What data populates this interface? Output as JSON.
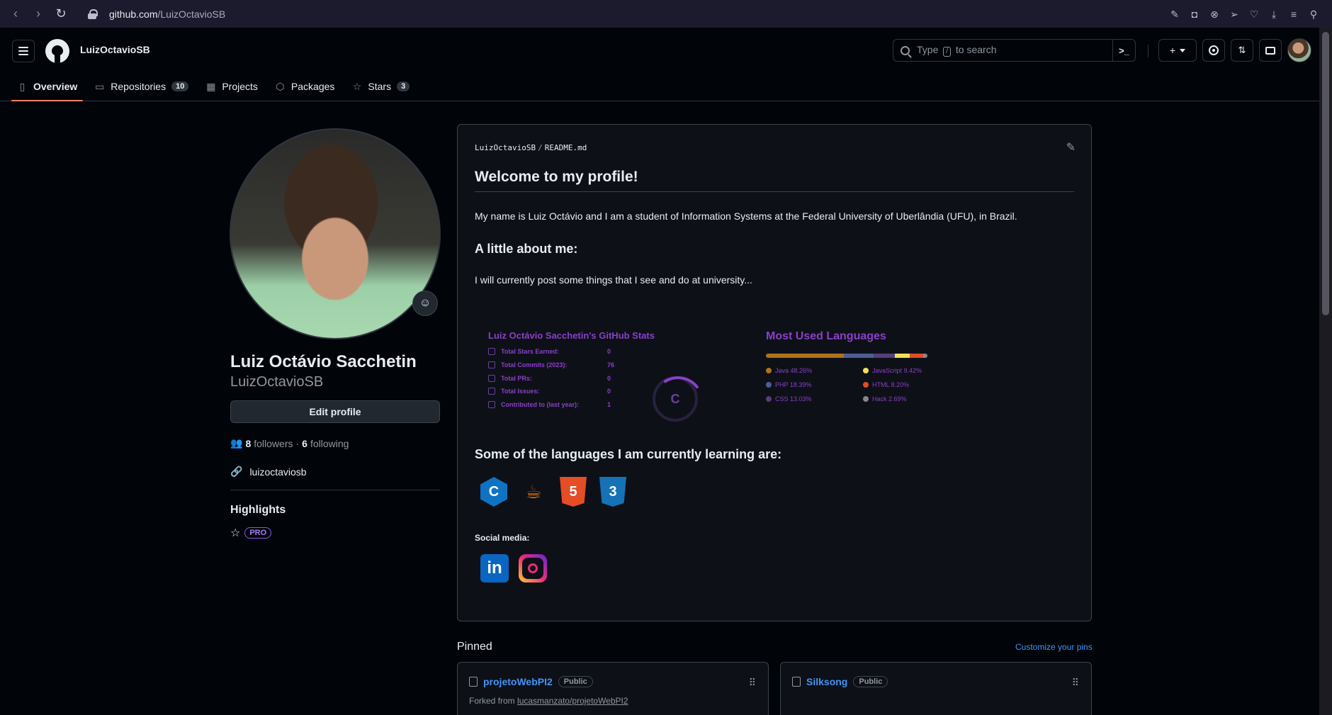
{
  "browser": {
    "url_host": "github.com",
    "url_path": "/LuizOctavioSB"
  },
  "header": {
    "username": "LuizOctavioSB",
    "search_prefix": "Type",
    "search_key": "/",
    "search_suffix": "to search",
    "plus_label": "+"
  },
  "tabs": [
    {
      "label": "Overview",
      "icon": "book-icon"
    },
    {
      "label": "Repositories",
      "icon": "repo-icon",
      "count": "10"
    },
    {
      "label": "Projects",
      "icon": "table-icon"
    },
    {
      "label": "Packages",
      "icon": "package-icon"
    },
    {
      "label": "Stars",
      "icon": "star-icon",
      "count": "3"
    }
  ],
  "profile": {
    "name": "Luiz Octávio Sacchetin",
    "login": "LuizOctavioSB",
    "edit_label": "Edit profile",
    "followers_count": "8",
    "followers_label": "followers",
    "dot": "·",
    "following_count": "6",
    "following_label": "following",
    "link": "luizoctaviosb",
    "highlights_title": "Highlights",
    "pro_label": "PRO"
  },
  "readme": {
    "crumb_user": "LuizOctavioSB",
    "crumb_sep": "/",
    "crumb_file": "README.md",
    "h1": "Welcome to my profile!",
    "intro": "My name is Luiz Octávio and I am a student of Information Systems at the Federal University of Uberlândia (UFU), in Brazil.",
    "about_title": "A little about me:",
    "about_text": "I will currently post some things that I see and do at university...",
    "learning_title": "Some of the languages I am currently learning are:",
    "social_title": "Social media:"
  },
  "stats_card": {
    "title": "Luiz Octávio Sacchetin's GitHub Stats",
    "rows": [
      {
        "label": "Total Stars Earned:",
        "value": "0"
      },
      {
        "label": "Total Commits (2023):",
        "value": "76"
      },
      {
        "label": "Total PRs:",
        "value": "0"
      },
      {
        "label": "Total Issues:",
        "value": "0"
      },
      {
        "label": "Contributed to (last year):",
        "value": "1"
      }
    ],
    "rank": "C"
  },
  "langs_card": {
    "title": "Most Used Languages",
    "items": [
      {
        "label": "Java 48.26%",
        "pct": 48.26,
        "color": "#b07219"
      },
      {
        "label": "JavaScript 9.42%",
        "pct": 9.42,
        "color": "#f1e05a"
      },
      {
        "label": "PHP 18.39%",
        "pct": 18.39,
        "color": "#4F5D95"
      },
      {
        "label": "HTML 8.20%",
        "pct": 8.2,
        "color": "#e34c26"
      },
      {
        "label": "CSS 13.03%",
        "pct": 13.03,
        "color": "#563d7c"
      },
      {
        "label": "Hack 2.69%",
        "pct": 2.69,
        "color": "#878787"
      }
    ]
  },
  "tech_icons": {
    "c": "C",
    "java": "☕",
    "html": "5",
    "css": "3"
  },
  "social": {
    "linkedin": "in"
  },
  "pinned": {
    "title": "Pinned",
    "customize": "Customize your pins",
    "repos": [
      {
        "name": "projetoWebPI2",
        "visibility": "Public",
        "forked_prefix": "Forked from",
        "forked_from": "lucasmanzato/projetoWebPI2"
      },
      {
        "name": "Silksong",
        "visibility": "Public"
      }
    ]
  },
  "colors": {
    "accent_underline": "#f78166",
    "link": "#4493f8",
    "stats_purple": "#8b3fc8"
  }
}
